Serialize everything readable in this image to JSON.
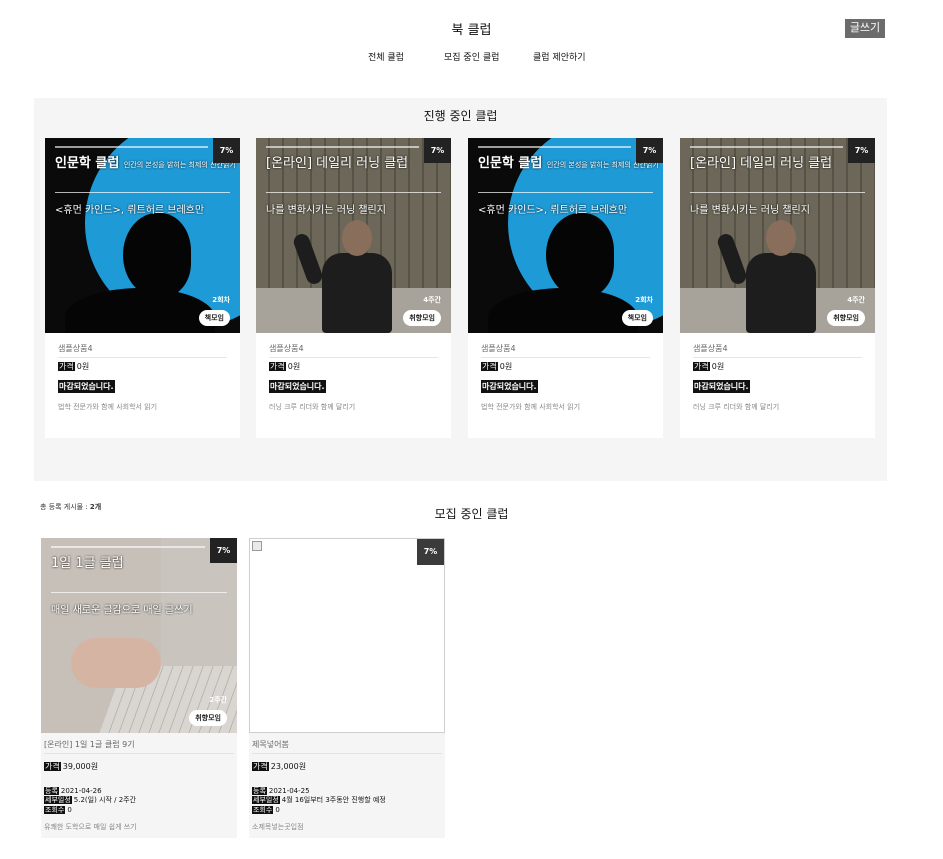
{
  "header": {
    "title": "북 클럽",
    "write_label": "글쓰기"
  },
  "nav": {
    "items": [
      "전체 클럽",
      "모집 중인 클럽",
      "클럽 제안하기"
    ]
  },
  "ongoing": {
    "title": "진행 중인 클럽",
    "cards": [
      {
        "percent": "7%",
        "thumb_title": "인문학 클럽",
        "thumb_title_small": "인간의 본성을 밝히는 최제의 신간읽기",
        "thumb_subtitle": "<휴먼 카인드>, 뤼트허르 브레흐만",
        "duration": "2회차",
        "badge": "책모임",
        "name": "샘플상품4",
        "price_tag": "가격",
        "price": "0원",
        "status": "마감되었습니다.",
        "desc": "법학 전문가와 함께 사회학서 읽기"
      },
      {
        "percent": "7%",
        "thumb_title": "[온라인] 데일리 러닝 클럽",
        "thumb_title_small": "",
        "thumb_subtitle": "나를 변화시키는 러닝 챌린지",
        "duration": "4주간",
        "badge": "취향모임",
        "name": "샘플상품4",
        "price_tag": "가격",
        "price": "0원",
        "status": "마감되었습니다.",
        "desc": "러닝 크루 리더와 함께 달리기"
      },
      {
        "percent": "7%",
        "thumb_title": "인문학 클럽",
        "thumb_title_small": "인간의 본성을 밝히는 최제의 신간읽기",
        "thumb_subtitle": "<휴먼 카인드>, 뤼트허르 브레흐만",
        "duration": "2회차",
        "badge": "책모임",
        "name": "샘플상품4",
        "price_tag": "가격",
        "price": "0원",
        "status": "마감되었습니다.",
        "desc": "법학 전문가와 함께 사회학서 읽기"
      },
      {
        "percent": "7%",
        "thumb_title": "[온라인] 데일리 러닝 클럽",
        "thumb_title_small": "",
        "thumb_subtitle": "나를 변화시키는 러닝 챌린지",
        "duration": "4주간",
        "badge": "취향모임",
        "name": "샘플상품4",
        "price_tag": "가격",
        "price": "0원",
        "status": "마감되었습니다.",
        "desc": "러닝 크루 리더와 함께 달리기"
      }
    ]
  },
  "total": {
    "label": "총 등록 게시물 :",
    "count": "2개"
  },
  "recruiting": {
    "title": "모집 중인 클럽",
    "cards": [
      {
        "percent": "7%",
        "thumb_title": "1일 1글 클럽",
        "thumb_subtitle": "매일 새로운 글감으로 매일 글쓰기",
        "duration": "2주간",
        "badge": "취향모임",
        "name": "[온라인] 1일 1글 클럽 9기",
        "price_tag": "가격",
        "price": "39,000원",
        "reg_tag": "등록",
        "reg": "2021-04-26",
        "sched_tag": "세부일정",
        "sched": "5.2(일) 시작 / 2주간",
        "views_tag": "조회수",
        "views": "0",
        "desc": "유쾌한 도학으로 매일 쉽게 쓰기"
      },
      {
        "percent": "7%",
        "name": "제목넣어봄",
        "price_tag": "가격",
        "price": "23,000원",
        "reg_tag": "등록",
        "reg": "2021-04-25",
        "sched_tag": "세부일정",
        "sched": "4월 16일부터 3주동안 진행할 예정",
        "views_tag": "조회수",
        "views": "0",
        "desc": "소제목넣는곳입점"
      }
    ]
  }
}
